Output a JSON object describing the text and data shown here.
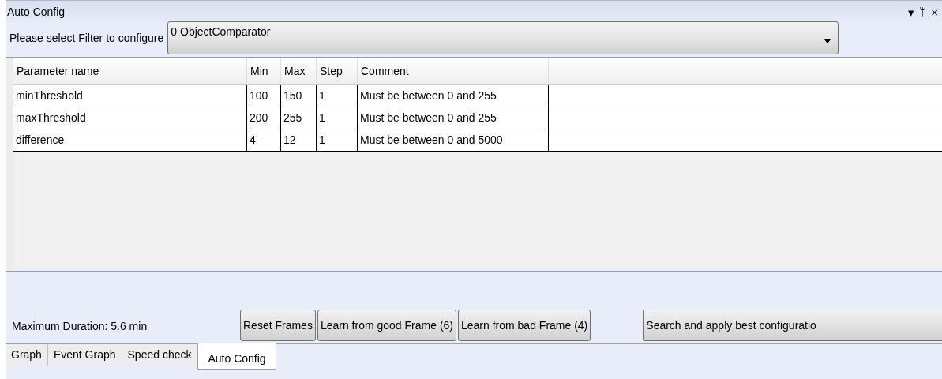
{
  "window": {
    "title": "Auto Config",
    "controls": [
      "▾",
      "ᛘ",
      "×"
    ]
  },
  "filter": {
    "label": "Please select Filter to configure",
    "value": "0 ObjectComparator"
  },
  "table": {
    "columns": [
      "Parameter name",
      "Min",
      "Max",
      "Step",
      "Comment"
    ],
    "rows": [
      {
        "cells": [
          "minThreshold",
          "100",
          "150",
          "1",
          "Must be between 0 and 255"
        ]
      },
      {
        "cells": [
          "maxThreshold",
          "200",
          "255",
          "1",
          "Must be between 0 and 255"
        ]
      },
      {
        "cells": [
          "difference",
          "4",
          "12",
          "1",
          "Must be between 0 and 5000"
        ]
      }
    ]
  },
  "duration": "Maximum Duration: 5.6 min",
  "buttons": [
    "Reset Frames",
    "Learn from good Frame (6)",
    "Learn from bad Frame (4)",
    "Search and apply best configuratio"
  ],
  "tabs": [
    {
      "label": "Graph",
      "selected": false
    },
    {
      "label": "Event Graph",
      "selected": false
    },
    {
      "label": "Speed check",
      "selected": false
    },
    {
      "label": "Auto Config",
      "selected": true
    }
  ]
}
